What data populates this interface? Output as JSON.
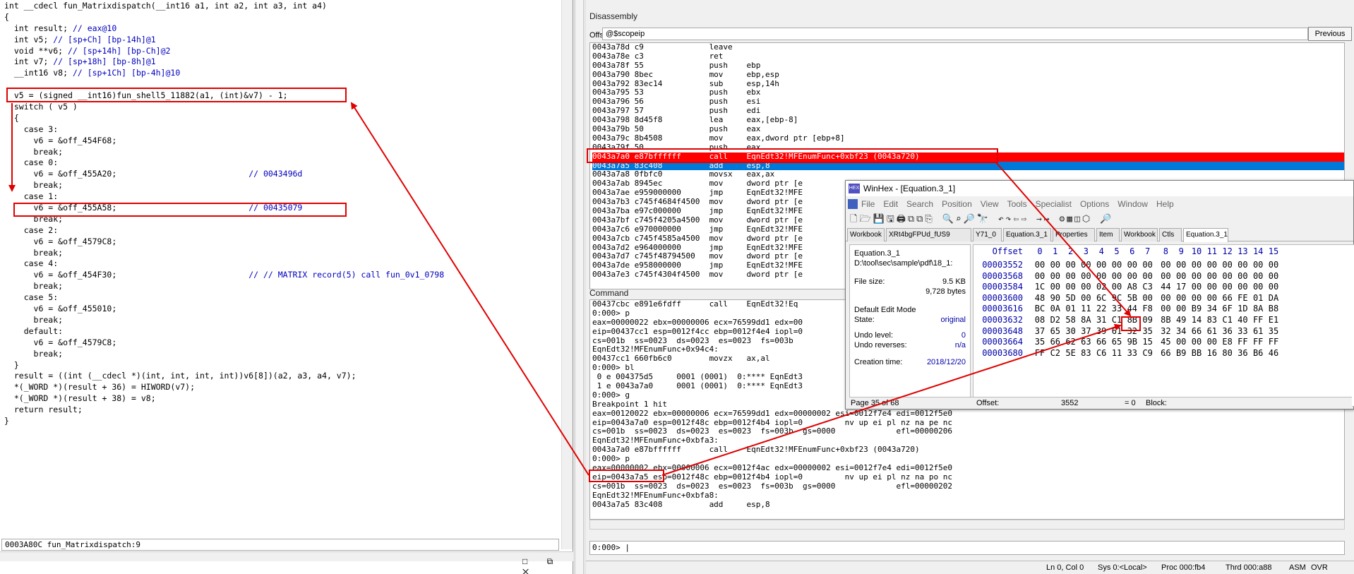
{
  "ida": {
    "code": [
      "int __cdecl fun_Matrixdispatch(__int16 a1, int a2, int a3, int a4)",
      "{",
      "  int result; // eax@10",
      "  int v5; // [sp+Ch] [bp-14h]@1",
      "  void **v6; // [sp+14h] [bp-Ch]@2",
      "  int v7; // [sp+18h] [bp-8h]@1",
      "  __int16 v8; // [sp+1Ch] [bp-4h]@10",
      "",
      "  v5 = (signed __int16)fun_shell5_11882(a1, (int)&v7) - 1;",
      "  switch ( v5 )",
      "  {",
      "    case 3:",
      "      v6 = &off_454F68;",
      "      break;",
      "    case 0:",
      "      v6 = &off_455A20;                           // 0043496d",
      "      break;",
      "    case 1:",
      "      v6 = &off_455A58;                           // 00435079",
      "      break;",
      "    case 2:",
      "      v6 = &off_4579C8;",
      "      break;",
      "    case 4:",
      "      v6 = &off_454F30;                           // // MATRIX record(5) call fun_0v1_0798",
      "      break;",
      "    case 5:",
      "      v6 = &off_455010;",
      "      break;",
      "    default:",
      "      v6 = &off_4579C8;",
      "      break;",
      "  }",
      "  result = ((int (__cdecl *)(int, int, int, int))v6[8])(a2, a3, a4, v7);",
      "  *(_WORD *)(result + 36) = HIWORD(v7);",
      "  *(_WORD *)(result + 38) = v8;",
      "  return result;",
      "}"
    ],
    "status": "0003A80C fun_Matrixdispatch:9",
    "window_buttons": "□ ⧉ ✕"
  },
  "disasm": {
    "title": "Disassembly",
    "offset_label": "Offset:",
    "offset_value": "@$scopeip",
    "previous_label": "Previous",
    "lines": [
      "0043a78d c9              leave",
      "0043a78e c3              ret",
      "0043a78f 55              push    ebp",
      "0043a790 8bec            mov     ebp,esp",
      "0043a792 83ec14          sub     esp,14h",
      "0043a795 53              push    ebx",
      "0043a796 56              push    esi",
      "0043a797 57              push    edi",
      "0043a798 8d45f8          lea     eax,[ebp-8]",
      "0043a79b 50              push    eax",
      "0043a79c 8b4508          mov     eax,dword ptr [ebp+8]",
      "0043a79f 50              push    eax",
      "0043a7a0 e87bffffff      call    EqnEdt32!MFEnumFunc+0xbf23 (0043a720)",
      "0043a7a5 83c408          add     esp,8",
      "0043a7a8 0fbfc0          movsx   eax,ax",
      "0043a7ab 8945ec          mov     dword ptr [e",
      "0043a7ae e959000000      jmp     EqnEdt32!MFE",
      "0043a7b3 c745f4684f4500  mov     dword ptr [e",
      "0043a7ba e97c000000      jmp     EqnEdt32!MFE",
      "0043a7bf c745f4205a4500  mov     dword ptr [e",
      "0043a7c6 e970000000      jmp     EqnEdt32!MFE",
      "0043a7cb c745f4585a4500  mov     dword ptr [e",
      "0043a7d2 e964000000      jmp     EqnEdt32!MFE",
      "0043a7d7 c745f48794500   mov     dword ptr [e",
      "0043a7de e958000000      jmp     EqnEdt32!MFE",
      "0043a7e3 c745f4304f4500  mov     dword ptr [e"
    ]
  },
  "command": {
    "title": "Command",
    "lines": [
      "00437cbc e891e6fdff      call    EqnEdt32!Eq",
      "0:000> p",
      "eax=00000022 ebx=00000006 ecx=76599dd1 edx=00",
      "eip=00437cc1 esp=0012f4cc ebp=0012f4e4 iopl=0",
      "cs=001b  ss=0023  ds=0023  es=0023  fs=003b",
      "EqnEdt32!MFEnumFunc+0x94c4:",
      "00437cc1 660fb6c0        movzx   ax,al",
      "0:000> bl",
      " 0 e 004375d5     0001 (0001)  0:**** EqnEdt3",
      " 1 e 0043a7a0     0001 (0001)  0:**** EqnEdt3",
      "0:000> g",
      "Breakpoint 1 hit",
      "eax=00120022 ebx=00000006 ecx=76599dd1 edx=00000002 esi=0012f7e4 edi=0012f5e0",
      "eip=0043a7a0 esp=0012f48c ebp=0012f4b4 iopl=0         nv up ei pl nz na pe nc",
      "cs=001b  ss=0023  ds=0023  es=0023  fs=003b  gs=0000             efl=00000206",
      "EqnEdt32!MFEnumFunc+0xbfa3:",
      "0043a7a0 e87bffffff      call    EqnEdt32!MFEnumFunc+0xbf23 (0043a720)",
      "0:000> p",
      "eax=00000002 ebx=00000006 ecx=0012f4ac edx=00000002 esi=0012f7e4 edi=0012f5e0",
      "eip=0043a7a5 esp=0012f48c ebp=0012f4b4 iopl=0         nv up ei pl nz na po nc",
      "cs=001b  ss=0023  ds=0023  es=0023  fs=003b  gs=0000             efl=00000202",
      "EqnEdt32!MFEnumFunc+0xbfa8:",
      "0043a7a5 83c408          add     esp,8"
    ],
    "prompt": "0:000> |"
  },
  "statusbar": {
    "ln_col": "Ln 0, Col 0",
    "sys": "Sys 0:<Local>",
    "proc": "Proc 000:fb4",
    "thrd": "Thrd 000:a88",
    "asm": "ASM",
    "ovr": "OVR"
  },
  "winhex": {
    "title": "WinHex - [Equation.3_1]",
    "menu": [
      "File",
      "Edit",
      "Search",
      "Position",
      "View",
      "Tools",
      "Specialist",
      "Options",
      "Window",
      "Help"
    ],
    "toolbar_icons": "🗋🗁💾🖫🖨⧉⧉⎘  🔍⌕🔎🔭  ↶↷⇦⇨  →↦  ⚙▦◫⬡  🔎",
    "tabs": [
      "Workbook",
      "XRt4bgFPUd_fUS9",
      "Y71_0",
      "Equation.3_1",
      "Properties",
      "Item",
      "Workbook",
      "Ctls",
      "Equation.3_1"
    ],
    "info": {
      "name": "Equation.3_1",
      "path": "D:\\tool\\sec\\sample\\pdf\\18_1:",
      "filesize_label": "File size:",
      "filesize_kb": "9.5 KB",
      "filesize_bytes": "9,728 bytes",
      "editmode_label": "Default Edit Mode",
      "state_label": "State:",
      "state_value": "original",
      "undo_level_label": "Undo level:",
      "undo_level_value": "0",
      "undo_rev_label": "Undo reverses:",
      "undo_rev_value": "n/a",
      "creation_label": "Creation time:",
      "creation_value": "2018/12/20"
    },
    "hex_header": [
      "Offset",
      "0",
      "1",
      "2",
      "3",
      "4",
      "5",
      "6",
      "7",
      "8",
      "9",
      "10",
      "11",
      "12",
      "13",
      "14",
      "15"
    ],
    "hex_rows": [
      {
        "off": "00003552",
        "b": [
          "00",
          "00",
          "00",
          "00",
          "00",
          "00",
          "00",
          "00",
          "00",
          "00",
          "00",
          "00",
          "00",
          "00",
          "00",
          "00"
        ]
      },
      {
        "off": "00003568",
        "b": [
          "00",
          "00",
          "00",
          "00",
          "00",
          "00",
          "00",
          "00",
          "00",
          "00",
          "00",
          "00",
          "00",
          "00",
          "00",
          "00"
        ]
      },
      {
        "off": "00003584",
        "b": [
          "1C",
          "00",
          "00",
          "00",
          "02",
          "00",
          "A8",
          "C3",
          "44",
          "17",
          "00",
          "00",
          "00",
          "00",
          "00",
          "00"
        ]
      },
      {
        "off": "00003600",
        "b": [
          "48",
          "90",
          "5D",
          "00",
          "6C",
          "9C",
          "5B",
          "00",
          "00",
          "00",
          "00",
          "00",
          "66",
          "FE",
          "01",
          "DA"
        ]
      },
      {
        "off": "00003616",
        "b": [
          "BC",
          "0A",
          "01",
          "11",
          "22",
          "33",
          "44",
          "F8",
          "00",
          "00",
          "B9",
          "34",
          "6F",
          "1D",
          "8A",
          "B8"
        ]
      },
      {
        "off": "00003632",
        "b": [
          "08",
          "D2",
          "58",
          "8A",
          "31",
          "C1",
          "8B",
          "09",
          "8B",
          "49",
          "14",
          "83",
          "C1",
          "40",
          "FF",
          "E1"
        ]
      },
      {
        "off": "00003648",
        "b": [
          "37",
          "65",
          "30",
          "37",
          "39",
          "61",
          "32",
          "35",
          "32",
          "34",
          "66",
          "61",
          "36",
          "33",
          "61",
          "35"
        ]
      },
      {
        "off": "00003664",
        "b": [
          "35",
          "66",
          "62",
          "63",
          "66",
          "65",
          "9B",
          "15",
          "45",
          "00",
          "00",
          "00",
          "E8",
          "FF",
          "FF",
          "FF"
        ]
      },
      {
        "off": "00003680",
        "b": [
          "FF",
          "C2",
          "5E",
          "83",
          "C6",
          "11",
          "33",
          "C9",
          "66",
          "B9",
          "BB",
          "16",
          "80",
          "36",
          "B6",
          "46"
        ]
      }
    ],
    "status": {
      "page": "Page 35 of 68",
      "offset_label": "Offset:",
      "offset_value": "3552",
      "eq": "= 0",
      "block": "Block:"
    }
  }
}
